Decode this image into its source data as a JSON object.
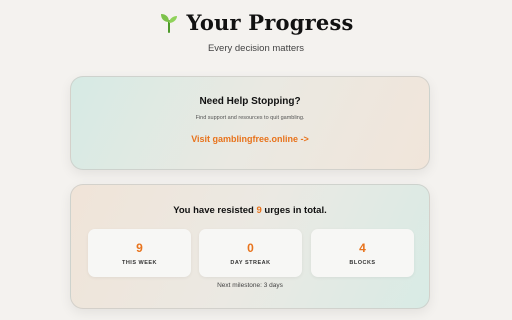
{
  "header": {
    "icon": "sprout-icon",
    "title": "Your Progress",
    "subtitle": "Every decision matters"
  },
  "help": {
    "title": "Need Help Stopping?",
    "description": "Find support and resources to quit gambling.",
    "link_label": "Visit gamblingfree.online ->"
  },
  "progress": {
    "resisted_prefix": "You have resisted ",
    "resisted_count": "9",
    "resisted_suffix": " urges in total.",
    "stats": [
      {
        "value": "9",
        "label": "THIS WEEK"
      },
      {
        "value": "0",
        "label": "DAY STREAK"
      },
      {
        "value": "4",
        "label": "BLOCKS"
      }
    ],
    "milestone": "Next milestone: 3 days"
  },
  "colors": {
    "accent": "#e8731c",
    "sprout_leaf": "#7cc24a",
    "sprout_stem": "#4e9a2a"
  }
}
